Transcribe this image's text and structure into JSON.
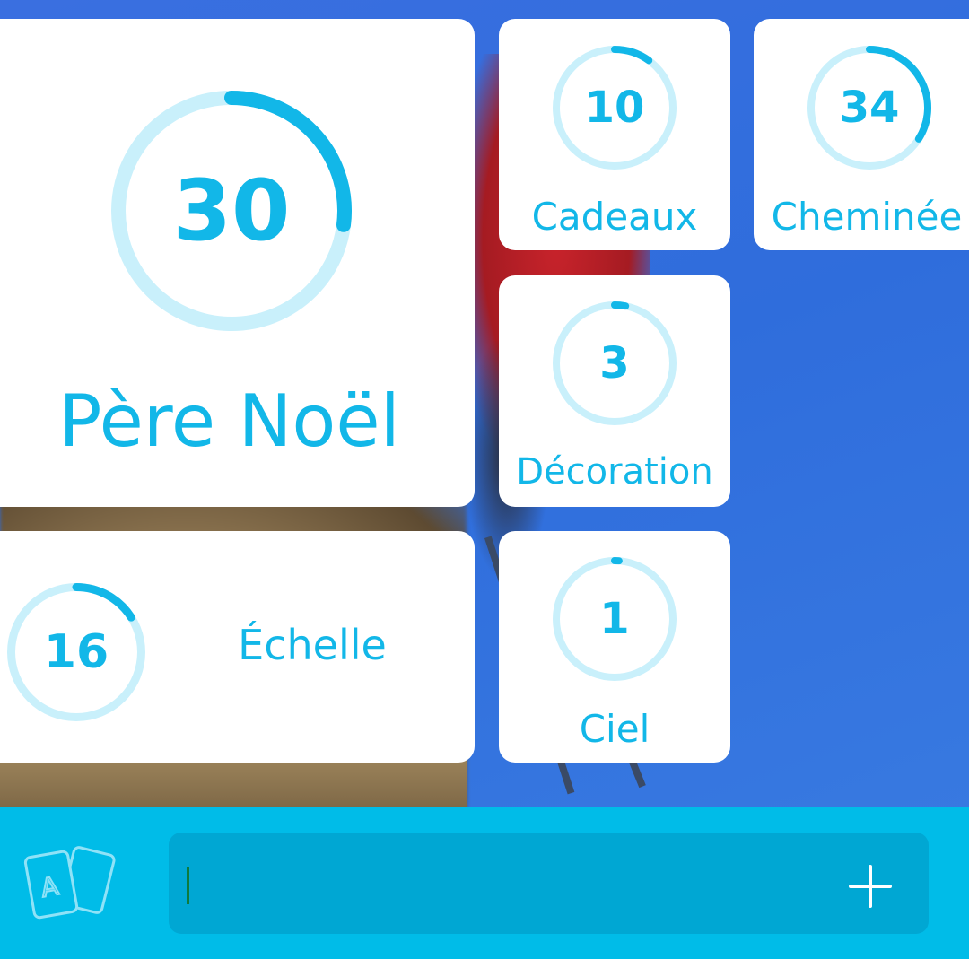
{
  "theme": {
    "accent": "#12b7e8",
    "ring_track": "#c9f0fb",
    "tile_bg": "#ffffff",
    "bar_bg": "#00bce8",
    "input_bg": "#00a7d3"
  },
  "answers": [
    {
      "id": "pere-noel",
      "count": "30",
      "label": "Père Noël",
      "progress": 0.27
    },
    {
      "id": "cadeaux",
      "count": "10",
      "label": "Cadeaux",
      "progress": 0.1
    },
    {
      "id": "cheminee",
      "count": "34",
      "label": "Cheminée",
      "progress": 0.34
    },
    {
      "id": "decoration",
      "count": "3",
      "label": "Décoration",
      "progress": 0.03
    },
    {
      "id": "echelle",
      "count": "16",
      "label": "Échelle",
      "progress": 0.16
    },
    {
      "id": "ciel",
      "count": "1",
      "label": "Ciel",
      "progress": 0.01
    }
  ],
  "bottom_bar": {
    "cards_icon": "playing-cards-icon",
    "input_value": "",
    "add_icon": "plus-icon"
  }
}
